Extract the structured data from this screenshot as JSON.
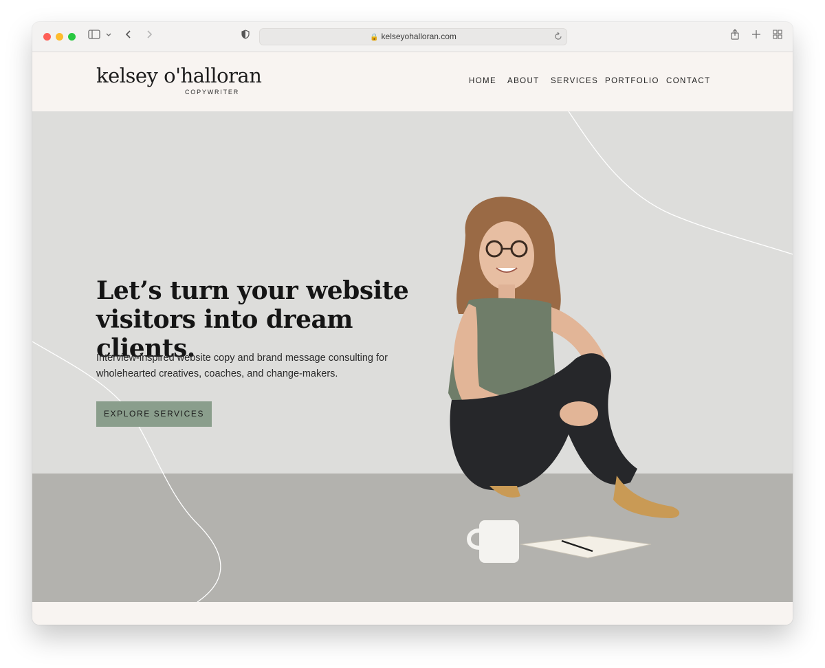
{
  "browser": {
    "url": "kelseyohalloran.com"
  },
  "site": {
    "logo_name": "kelsey o'halloran",
    "logo_tagline": "COPYWRITER",
    "nav": [
      "HOME",
      "ABOUT",
      "SERVICES",
      "PORTFOLIO",
      "CONTACT"
    ]
  },
  "hero": {
    "headline_line1": "Let’s turn your website",
    "headline_line2": "visitors into dream clients.",
    "sub_line1": "Interview-inspired website copy and brand message consulting for",
    "sub_line2": "wholehearted creatives, coaches, and change-makers.",
    "cta_label": "EXPLORE SERVICES"
  },
  "colors": {
    "accent_button": "#8a9e8c",
    "header_bg": "#f8f4f1",
    "wall": "#dddddb",
    "floor": "#b3b2ae"
  }
}
